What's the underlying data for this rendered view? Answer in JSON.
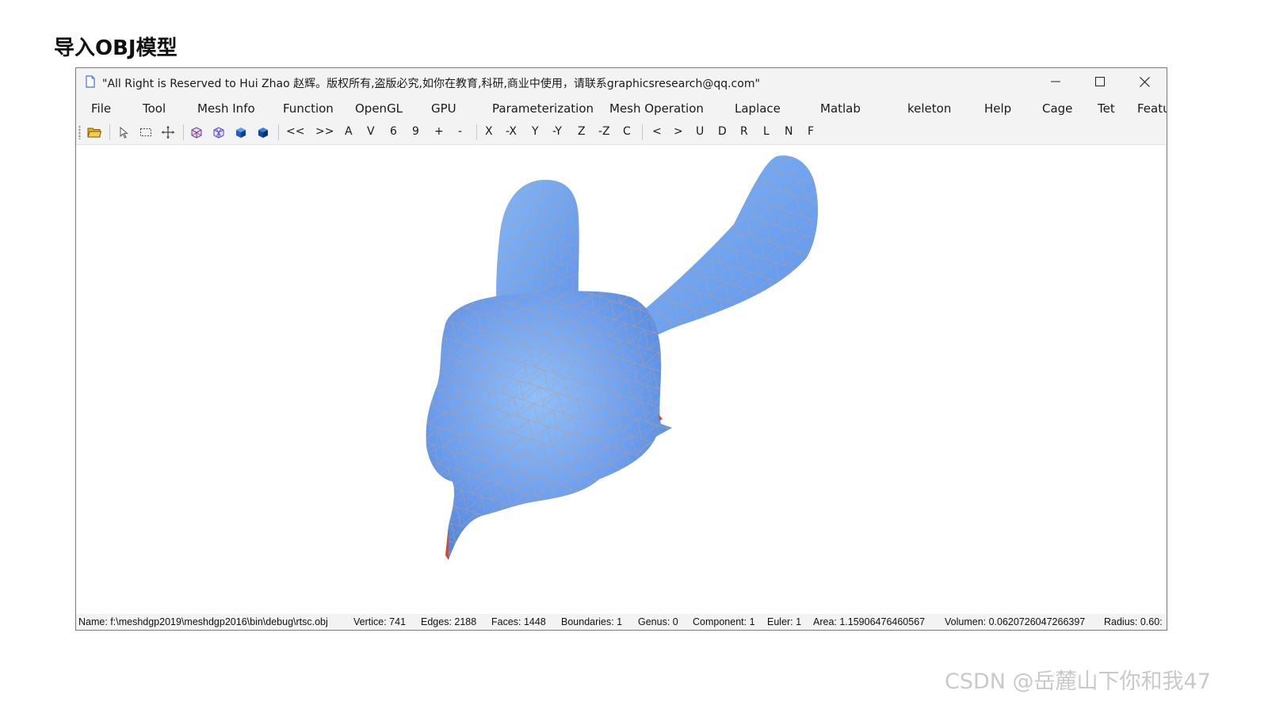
{
  "slide": {
    "heading": "导入OBJ模型"
  },
  "window": {
    "title": "\"All Right is Reserved to Hui Zhao 赵辉。版权所有,盗版必究,如你在教育,科研,商业中使用，请联系graphicsresearch@qq.com\"",
    "controls": {
      "minimize": "—",
      "maximize": "☐",
      "close": "✕"
    }
  },
  "menu": [
    "File",
    "Tool",
    "Mesh Info",
    "Function",
    "OpenGL",
    "GPU",
    "Parameterization",
    "Mesh Operation",
    "Laplace",
    "Matlab",
    "keleton",
    "Help",
    "Cage",
    "Tet",
    "Featu"
  ],
  "toolbar": {
    "icons": [
      "open-folder-icon",
      "select-pointer-icon",
      "rect-select-icon",
      "move-icon",
      "wireframe-cube-icon",
      "wireframe-cube-alt-icon",
      "solid-cube-icon",
      "solid-cube-dark-icon"
    ],
    "text_buttons": [
      "<<",
      ">>",
      "A",
      "V",
      "6",
      "9",
      "+",
      "-",
      "X",
      "-X",
      "Y",
      "-Y",
      "Z",
      "-Z",
      "C",
      "<",
      ">",
      "U",
      "D",
      "R",
      "L",
      "N",
      "F"
    ]
  },
  "mesh_colors": {
    "fill": "#6a9ff2",
    "edge": "#b89a92",
    "highlight": "#8fc1fb",
    "shadow": "#4f86dd"
  },
  "status": {
    "name": "Name: f:\\meshdgp2019\\meshdgp2016\\bin\\debug\\rtsc.obj",
    "vertex": "Vertice: 741",
    "edges": "Edges: 2188",
    "faces": "Faces: 1448",
    "boundaries": "Boundaries: 1",
    "genus": "Genus: 0",
    "component": "Component: 1",
    "euler": "Euler: 1",
    "area": "Area: 1.15906476460567",
    "volume": "Volumen: 0.0620726047266397",
    "radius": "Radius: 0.60:"
  },
  "watermark": "CSDN @岳麓山下你和我47"
}
